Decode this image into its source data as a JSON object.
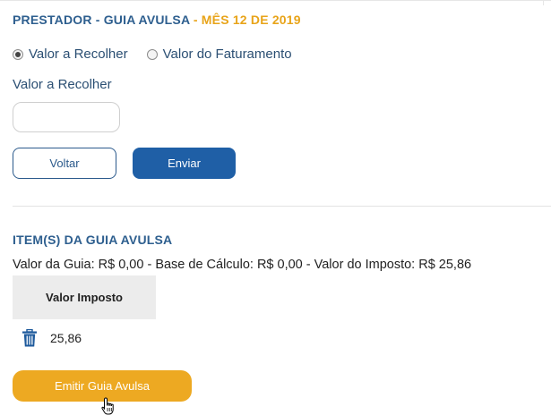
{
  "header": {
    "title_main": "PRESTADOR - GUIA AVULSA",
    "title_sep": " - ",
    "title_month": "MÊS 12 DE 2019"
  },
  "colors": {
    "title_blue": "#2e5f8f",
    "month_orange": "#e8a41a",
    "primary_button": "#1f5fa6",
    "emit_button": "#eda922"
  },
  "form": {
    "radio_options": [
      {
        "label": "Valor a Recolher",
        "selected": true
      },
      {
        "label": "Valor do Faturamento",
        "selected": false
      }
    ],
    "field_label": "Valor a Recolher",
    "field_value": "",
    "field_placeholder": "",
    "back_button": "Voltar",
    "submit_button": "Enviar"
  },
  "items": {
    "section_title": "ITEM(S) DA GUIA AVULSA",
    "summary": "Valor da Guia: R$ 0,00 - Base de Cálculo: R$ 0,00 - Valor do Imposto: R$ 25,86",
    "column_header": "Valor Imposto",
    "rows": [
      {
        "value": "25,86",
        "action_icon": "trash-icon"
      }
    ],
    "emit_button": "Emitir Guia Avulsa"
  },
  "icons": {
    "delete": "trash-icon",
    "cursor": "hand-pointer-cursor"
  }
}
